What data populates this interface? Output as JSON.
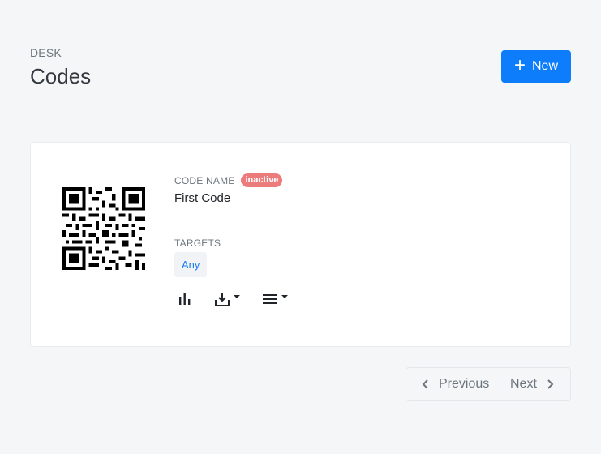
{
  "header": {
    "eyebrow": "DESK",
    "title": "Codes"
  },
  "new_button": {
    "label": "New",
    "icon": "plus-icon",
    "color": "#0d7dfb"
  },
  "card": {
    "code_name_label": "CODE NAME",
    "status_badge": "inactive",
    "status_color": "#ec7c7c",
    "code_name": "First Code",
    "targets_label": "TARGETS",
    "targets": [
      "Any"
    ],
    "actions": [
      "bar-chart-icon",
      "download-icon",
      "menu-icon"
    ]
  },
  "pagination": {
    "previous": "Previous",
    "next": "Next"
  }
}
